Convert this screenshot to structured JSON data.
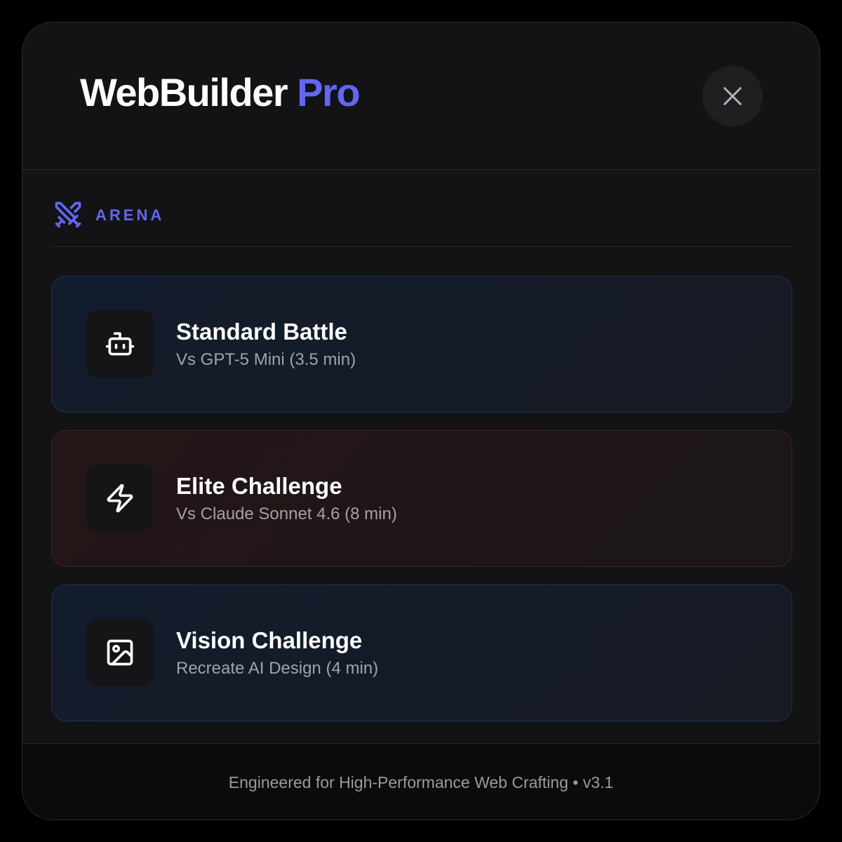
{
  "header": {
    "brand_name": "WebBuilder",
    "brand_suffix": "Pro",
    "close_icon": "close-icon"
  },
  "section": {
    "label": "ARENA",
    "icon": "crossed-swords-icon"
  },
  "modes": [
    {
      "title": "Standard Battle",
      "subtitle": "Vs GPT-5 Mini (3.5 min)",
      "icon": "robot-icon",
      "theme": "blue"
    },
    {
      "title": "Elite Challenge",
      "subtitle": "Vs Claude Sonnet 4.6 (8 min)",
      "icon": "lightning-icon",
      "theme": "red"
    },
    {
      "title": "Vision Challenge",
      "subtitle": "Recreate AI Design (4 min)",
      "icon": "image-icon",
      "theme": "blue"
    }
  ],
  "footer": {
    "text": "Engineered for High-Performance Web Crafting • v3.1"
  },
  "colors": {
    "accent": "#6366f1",
    "background": "#131315",
    "card_blue_border": "#1f3456",
    "card_red_border": "#4a1f24",
    "muted_text": "#a2a2aa"
  }
}
